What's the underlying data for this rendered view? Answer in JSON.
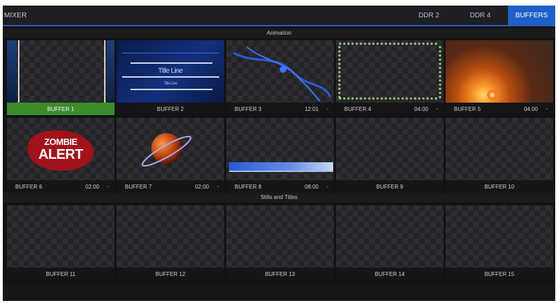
{
  "topbar": {
    "title": "MIXER",
    "tabs": [
      {
        "label": "DDR 2",
        "active": false
      },
      {
        "label": "DDR 4",
        "active": false
      },
      {
        "label": "BUFFERS",
        "active": true
      }
    ]
  },
  "sections": {
    "animation": "Animation",
    "stills": "Stills and Titles"
  },
  "buffers": [
    {
      "name": "BUFFER 1",
      "time": "",
      "active": true
    },
    {
      "name": "BUFFER 2",
      "time": "",
      "active": false,
      "art_text": [
        "Title Line",
        "Title Line"
      ]
    },
    {
      "name": "BUFFER 3",
      "time": "12:01",
      "active": false
    },
    {
      "name": "BUFFER 4",
      "time": "04:00",
      "active": false
    },
    {
      "name": "BUFFER 5",
      "time": "04:00",
      "active": false
    },
    {
      "name": "BUFFER 6",
      "time": "02:00",
      "active": false,
      "art_text": [
        "ZOMBIE",
        "ALERT"
      ]
    },
    {
      "name": "BUFFER 7",
      "time": "02:00",
      "active": false
    },
    {
      "name": "BUFFER 8",
      "time": "08:00",
      "active": false
    },
    {
      "name": "BUFFER 9",
      "time": "",
      "active": false
    },
    {
      "name": "BUFFER 10",
      "time": "",
      "active": false
    },
    {
      "name": "BUFFER 11",
      "time": "",
      "active": false
    },
    {
      "name": "BUFFER 12",
      "time": "",
      "active": false
    },
    {
      "name": "BUFFER 13",
      "time": "",
      "active": false
    },
    {
      "name": "BUFFER 14",
      "time": "",
      "active": false
    },
    {
      "name": "BUFFER 15",
      "time": "",
      "active": false
    }
  ],
  "colors": {
    "accent": "#1f5fc8",
    "active_buffer": "#3d8a2b",
    "background": "#121214"
  }
}
